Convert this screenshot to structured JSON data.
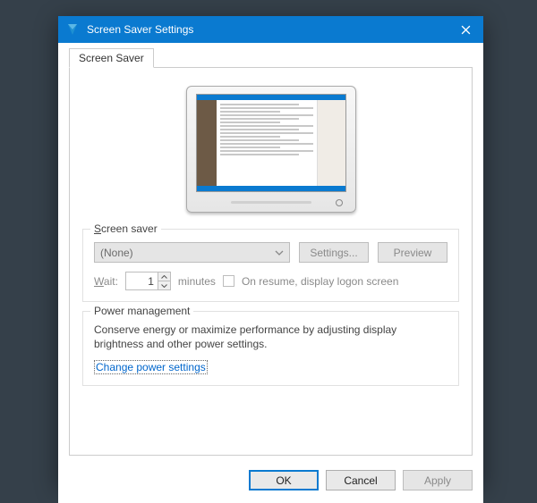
{
  "titlebar": {
    "title": "Screen Saver Settings"
  },
  "tab": {
    "label": "Screen Saver"
  },
  "screensaver": {
    "group_title": "Screen saver",
    "selected": "(None)",
    "settings_btn": "Settings...",
    "preview_btn": "Preview",
    "wait_label": "Wait:",
    "wait_value": "1",
    "wait_unit": "minutes",
    "resume_label": "On resume, display logon screen"
  },
  "power": {
    "group_title": "Power management",
    "text": "Conserve energy or maximize performance by adjusting display brightness and other power settings.",
    "link": "Change power settings"
  },
  "footer": {
    "ok": "OK",
    "cancel": "Cancel",
    "apply": "Apply"
  }
}
